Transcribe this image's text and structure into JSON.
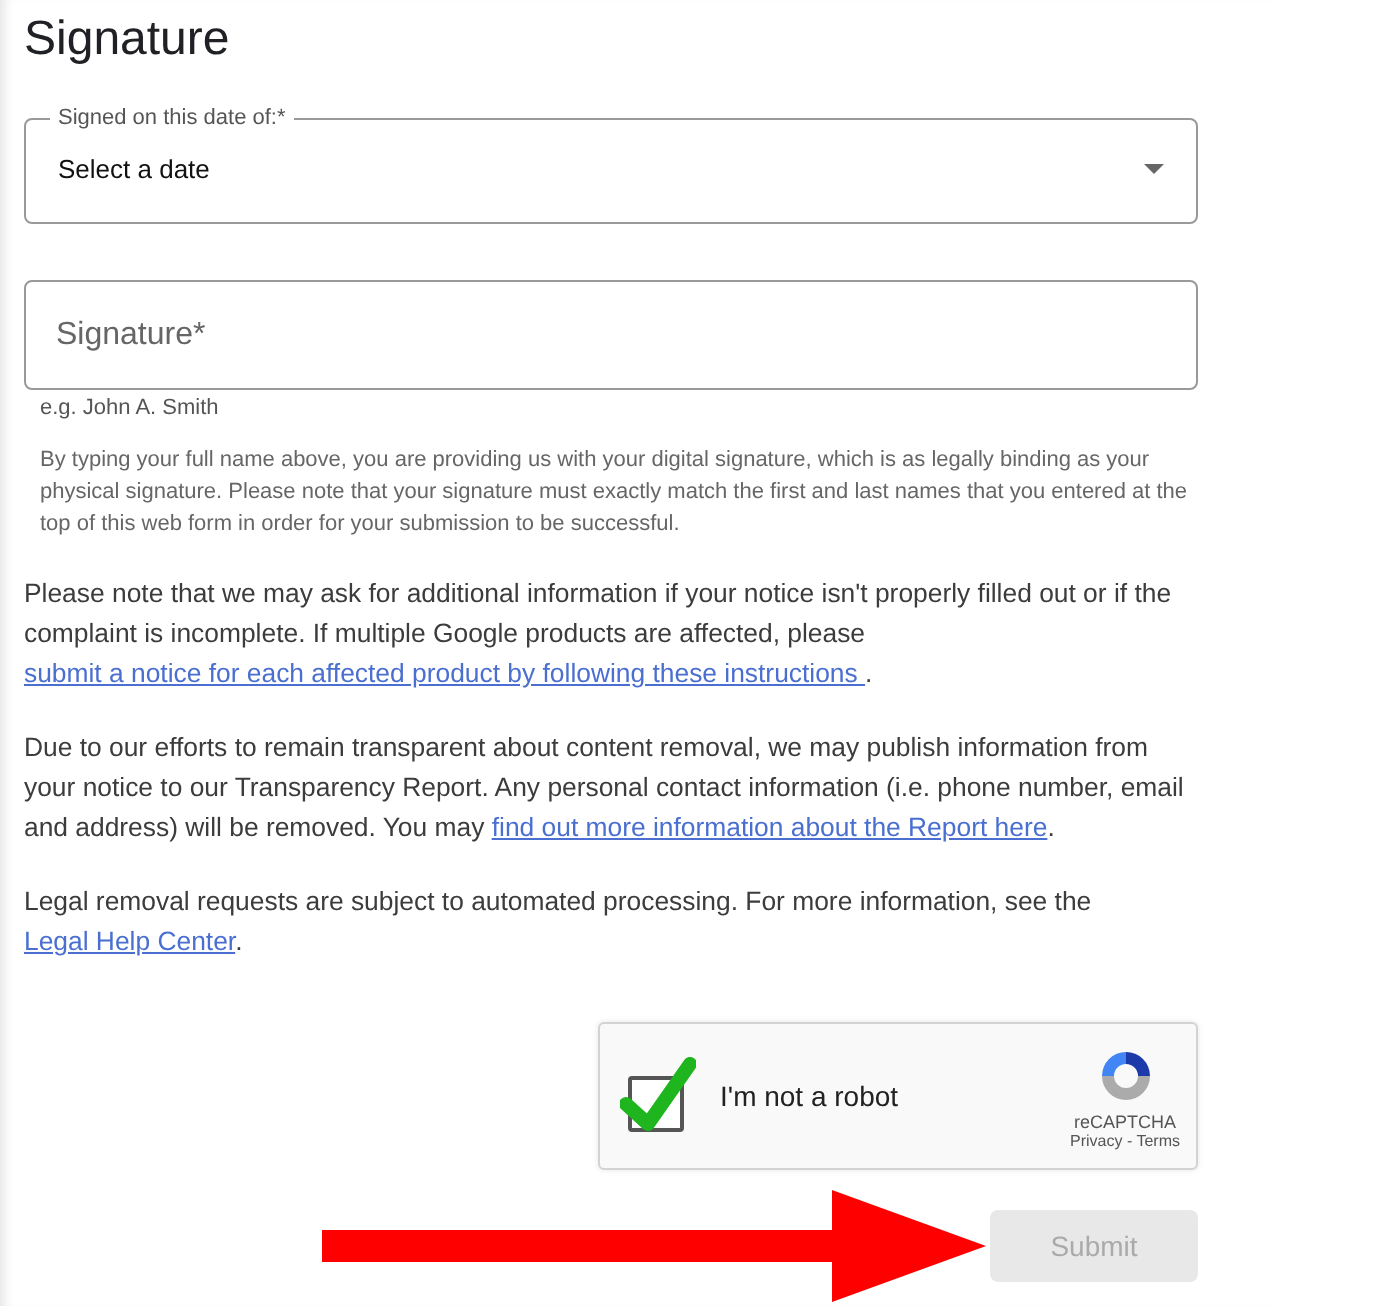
{
  "heading": "Signature",
  "date_field": {
    "label": "Signed on this date of:*",
    "value": "Select a date"
  },
  "signature_field": {
    "placeholder": "Signature*",
    "hint": "e.g. John A. Smith"
  },
  "disclaimer": "By typing your full name above, you are providing us with your digital signature, which is as legally binding as your physical signature. Please note that your signature must exactly match the first and last names that you entered at the top of this web form in order for your submission to be successful.",
  "paragraphs": [
    [
      {
        "kind": "text",
        "text": "Please note that we may ask for additional information if your notice isn't properly filled out or if the complaint is incomplete. If multiple Google products are affected, please "
      },
      {
        "kind": "link",
        "text": "submit a notice for each affected product by following these instructions "
      },
      {
        "kind": "text",
        "text": "."
      }
    ],
    [
      {
        "kind": "text",
        "text": "Due to our efforts to remain transparent about content removal, we may publish information from your notice to our Transparency Report. Any personal contact information (i.e. phone number, email and address) will be removed. You may "
      },
      {
        "kind": "link",
        "text": "find out more information about the Report here"
      },
      {
        "kind": "text",
        "text": "."
      }
    ],
    [
      {
        "kind": "text",
        "text": "Legal removal requests are subject to automated processing. For more information, see the "
      },
      {
        "kind": "link",
        "text": "Legal Help Center"
      },
      {
        "kind": "text",
        "text": "."
      }
    ]
  ],
  "captcha": {
    "label": "I'm not a robot",
    "checked": true,
    "brand": "reCAPTCHA",
    "links": "Privacy - Terms"
  },
  "submit": {
    "label": "Submit",
    "disabled": true
  }
}
